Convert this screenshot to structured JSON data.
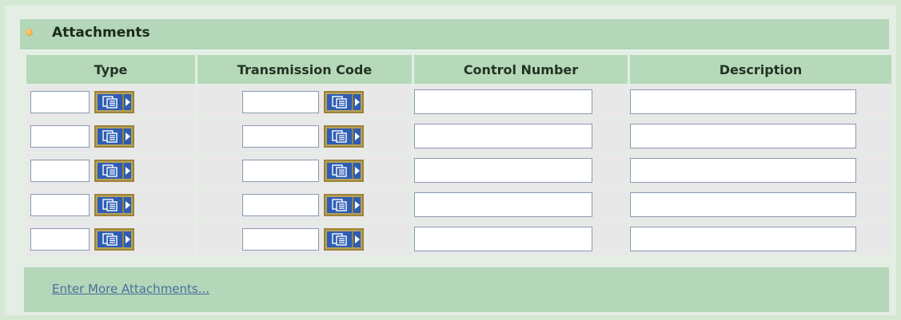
{
  "section": {
    "title": "Attachments"
  },
  "columns": [
    "Type",
    "Transmission Code",
    "Control Number",
    "Description"
  ],
  "rows": [
    {
      "type": "",
      "transmission_code": "",
      "control_number": "",
      "description": ""
    },
    {
      "type": "",
      "transmission_code": "",
      "control_number": "",
      "description": ""
    },
    {
      "type": "",
      "transmission_code": "",
      "control_number": "",
      "description": ""
    },
    {
      "type": "",
      "transmission_code": "",
      "control_number": "",
      "description": ""
    },
    {
      "type": "",
      "transmission_code": "",
      "control_number": "",
      "description": ""
    }
  ],
  "footer": {
    "link_label": "Enter More Attachments..."
  },
  "icons": {
    "lookup": "lookup-list-icon",
    "arrow": "right-arrow-icon",
    "bullet": "bullet-icon"
  },
  "colors": {
    "header_bg": "#b3d7b8",
    "row_bg": "#e8e8e8",
    "lookup_btn": "#2d5db4",
    "lookup_border": "#b8a15a",
    "bullet": "#f2901a",
    "link": "#4a6e9c"
  }
}
